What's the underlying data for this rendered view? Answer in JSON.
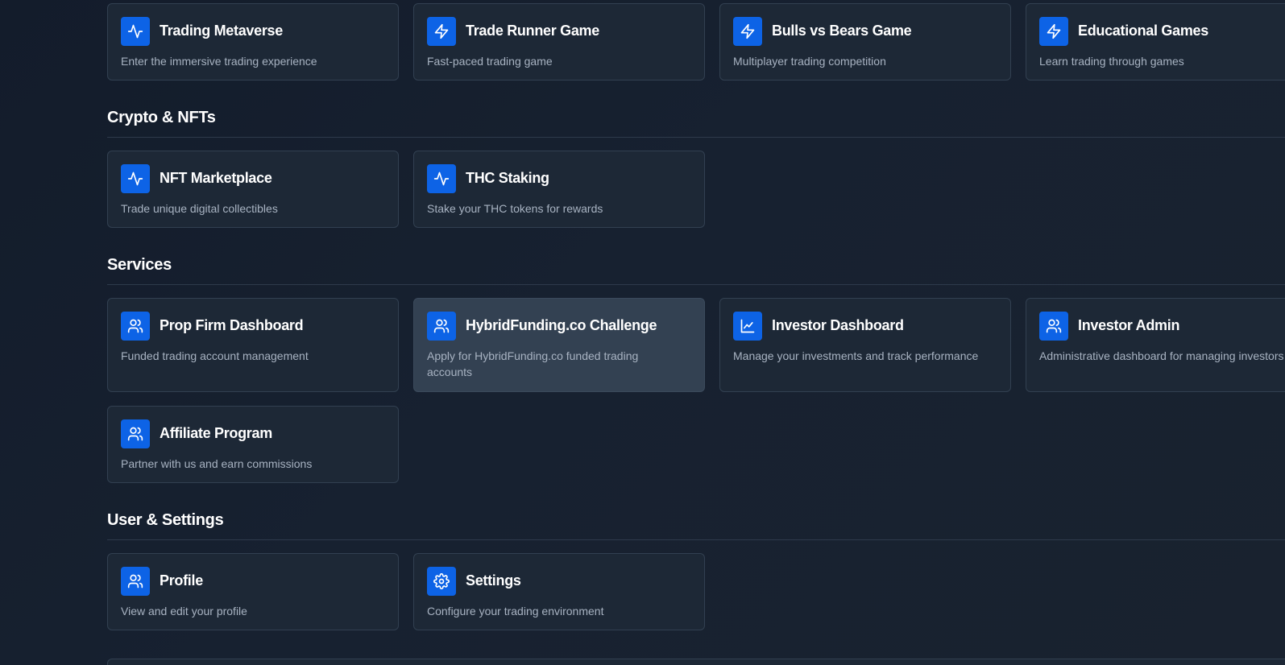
{
  "accent_color": "#0d63e6",
  "games": {
    "cards": [
      {
        "icon": "activity-icon",
        "title": "Trading Metaverse",
        "description": "Enter the immersive trading experience"
      },
      {
        "icon": "lightning-icon",
        "title": "Trade Runner Game",
        "description": "Fast-paced trading game"
      },
      {
        "icon": "lightning-icon",
        "title": "Bulls vs Bears Game",
        "description": "Multiplayer trading competition"
      },
      {
        "icon": "lightning-icon",
        "title": "Educational Games",
        "description": "Learn trading through games"
      }
    ]
  },
  "crypto": {
    "title": "Crypto & NFTs",
    "cards": [
      {
        "icon": "activity-icon",
        "title": "NFT Marketplace",
        "description": "Trade unique digital collectibles"
      },
      {
        "icon": "activity-icon",
        "title": "THC Staking",
        "description": "Stake your THC tokens for rewards"
      }
    ]
  },
  "services": {
    "title": "Services",
    "cards": [
      {
        "icon": "users-icon",
        "title": "Prop Firm Dashboard",
        "description": "Funded trading account management"
      },
      {
        "icon": "users-icon",
        "title": "HybridFunding.co Challenge",
        "description": "Apply for HybridFunding.co funded trading accounts"
      },
      {
        "icon": "line-chart-icon",
        "title": "Investor Dashboard",
        "description": "Manage your investments and track performance"
      },
      {
        "icon": "users-icon",
        "title": "Investor Admin",
        "description": "Administrative dashboard for managing investors"
      },
      {
        "icon": "users-icon",
        "title": "Affiliate Program",
        "description": "Partner with us and earn commissions"
      }
    ]
  },
  "user_settings": {
    "title": "User & Settings",
    "cards": [
      {
        "icon": "users-icon",
        "title": "Profile",
        "description": "View and edit your profile"
      },
      {
        "icon": "gear-icon",
        "title": "Settings",
        "description": "Configure your trading environment"
      }
    ]
  }
}
